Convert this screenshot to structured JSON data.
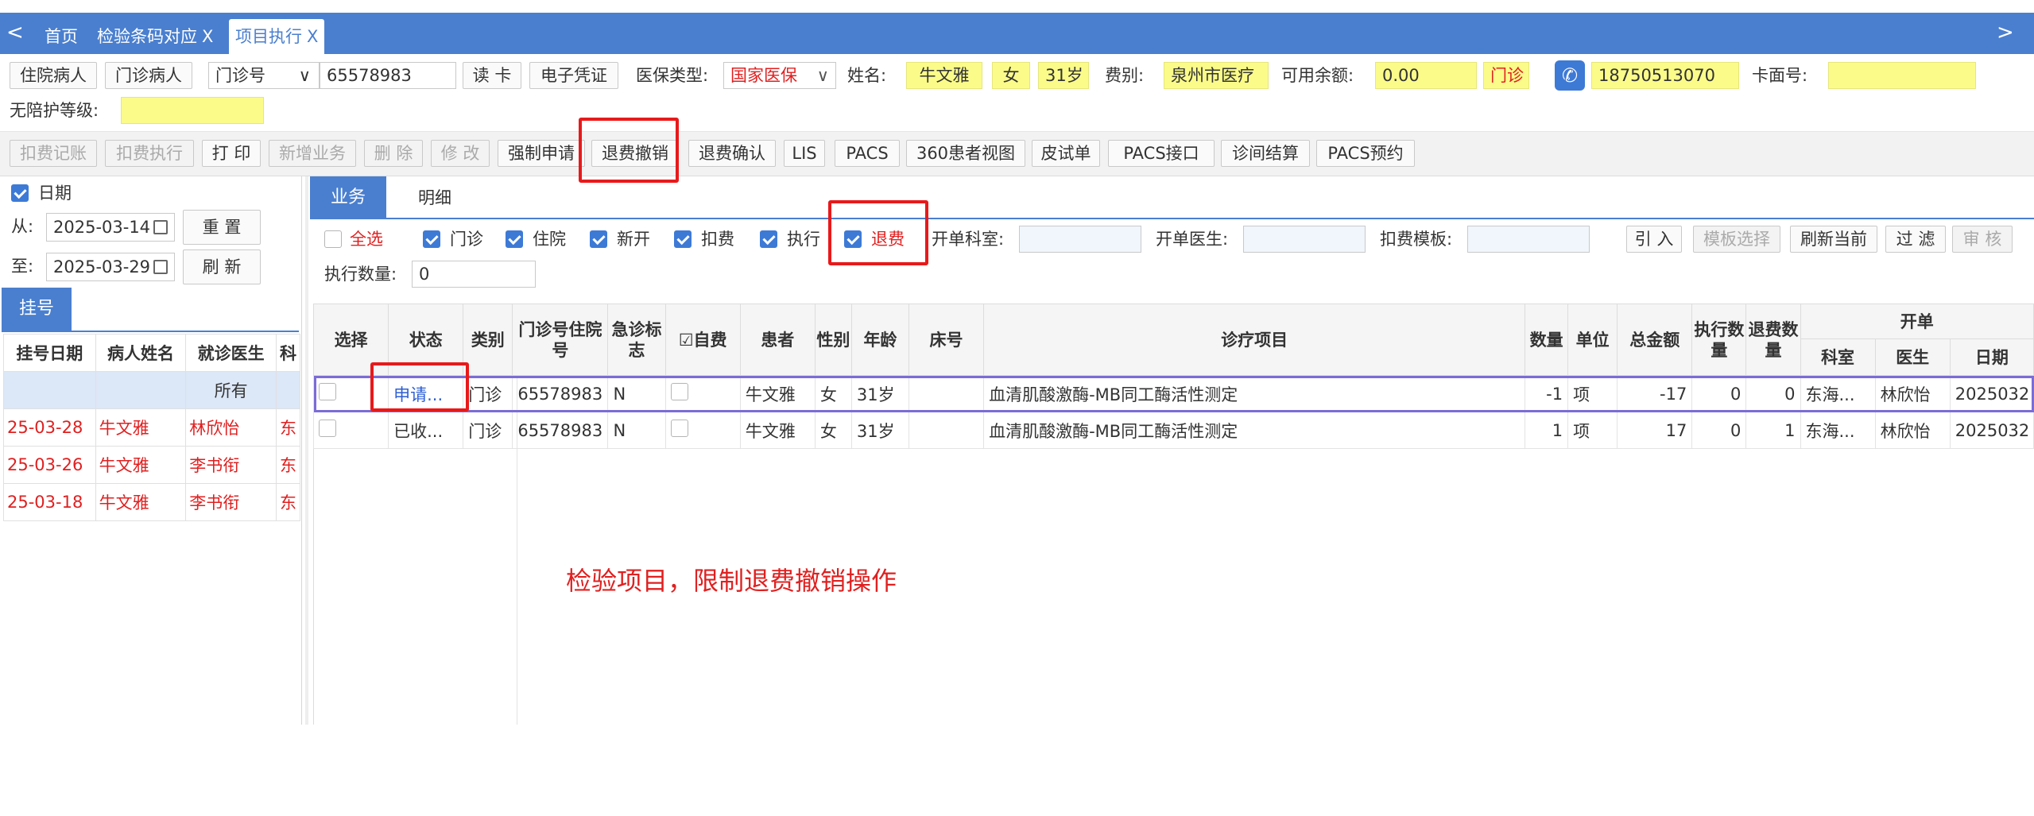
{
  "tabs": [
    {
      "label": "首页",
      "closable": false
    },
    {
      "label": "检验条码对应",
      "closable": true
    },
    {
      "label": "项目执行",
      "closable": true,
      "active": true
    }
  ],
  "nav": {
    "prev": "<",
    "next": ">"
  },
  "patient_bar": {
    "btn_inpatient": "住院病人",
    "btn_outpatient": "门诊病人",
    "id_type": "门诊号",
    "id_value": "65578983",
    "btn_read_card": "读 卡",
    "btn_e_voucher": "电子凭证",
    "insurance_label": "医保类型:",
    "insurance_value": "国家医保",
    "name_label": "姓名:",
    "name_value": "牛文雅",
    "gender": "女",
    "age": "31岁",
    "fee_label": "费别:",
    "fee_value": "泉州市医疗",
    "balance_label": "可用余额:",
    "balance_value": "0.00",
    "visit_type": "门诊",
    "phone": "18750513070",
    "card_label": "卡面号:",
    "card_value": "",
    "care_label": "无陪护等级:",
    "care_value": ""
  },
  "toolbar": [
    {
      "label": "扣费记账",
      "disabled": true
    },
    {
      "label": "扣费执行",
      "disabled": true
    },
    {
      "label": "打 印",
      "disabled": false
    },
    {
      "label": "新增业务",
      "disabled": true
    },
    {
      "label": "删 除",
      "disabled": true
    },
    {
      "label": "修 改",
      "disabled": true
    },
    {
      "label": "强制申请",
      "disabled": false
    },
    {
      "label": "退费撤销",
      "disabled": false
    },
    {
      "label": "退费确认",
      "disabled": false
    },
    {
      "label": "LIS",
      "disabled": false
    },
    {
      "label": "PACS",
      "disabled": false
    },
    {
      "label": "360患者视图",
      "disabled": false
    },
    {
      "label": "皮试单",
      "disabled": false
    },
    {
      "label": "PACS接口",
      "disabled": false
    },
    {
      "label": "诊间结算",
      "disabled": false
    },
    {
      "label": "PACS预约",
      "disabled": false
    }
  ],
  "left": {
    "date_check": "日期",
    "from_label": "从:",
    "from_value": "2025-03-14",
    "to_label": "至:",
    "to_value": "2025-03-29",
    "btn_reset": "重 置",
    "btn_refresh": "刷 新",
    "tab_register": "挂号",
    "headers": [
      "挂号日期",
      "病人姓名",
      "就诊医生",
      "科"
    ],
    "filter_all": "所有",
    "rows": [
      [
        "25-03-28",
        "牛文雅",
        "林欣怡",
        "东"
      ],
      [
        "25-03-26",
        "牛文雅",
        "李书衔",
        "东"
      ],
      [
        "25-03-18",
        "牛文雅",
        "李书衔",
        "东"
      ]
    ]
  },
  "main": {
    "tab_business": "业务",
    "tab_detail": "明细",
    "filters": {
      "all": "全选",
      "outpatient": "门诊",
      "inpatient": "住院",
      "new": "新开",
      "charge": "扣费",
      "execute": "执行",
      "refund": "退费"
    },
    "dept_label": "开单科室:",
    "doctor_label": "开单医生:",
    "template_label": "扣费模板:",
    "btn_import": "引 入",
    "btn_template": "模板选择",
    "btn_refresh_current": "刷新当前",
    "btn_filter": "过 滤",
    "btn_audit": "审 核",
    "exec_qty_label": "执行数量:",
    "exec_qty_value": "0",
    "headers": {
      "select": "选择",
      "status": "状态",
      "category": "类别",
      "visit_no": "门诊号住院号",
      "urgent": "急诊标志",
      "self_pay": "自费",
      "patient": "患者",
      "gender": "性别",
      "age": "年龄",
      "bed": "床号",
      "item": "诊疗项目",
      "qty": "数量",
      "unit": "单位",
      "total": "总金额",
      "exec_qty": "执行数量",
      "refund_qty": "退费数量",
      "order_group": "开单",
      "dept": "科室",
      "doctor": "医生",
      "date": "日期"
    },
    "rows": [
      {
        "status": "申请...",
        "category": "门诊",
        "visit_no": "65578983",
        "urgent": "N",
        "patient": "牛文雅",
        "gender": "女",
        "age": "31岁",
        "bed": "",
        "item": "血清肌酸激酶-MB同工酶活性测定",
        "qty": "-1",
        "unit": "项",
        "total": "-17",
        "exec_qty": "0",
        "refund_qty": "0",
        "dept": "东海...",
        "doctor": "林欣怡",
        "date": "2025032"
      },
      {
        "status": "已收...",
        "category": "门诊",
        "visit_no": "65578983",
        "urgent": "N",
        "patient": "牛文雅",
        "gender": "女",
        "age": "31岁",
        "bed": "",
        "item": "血清肌酸激酶-MB同工酶活性测定",
        "qty": "1",
        "unit": "项",
        "total": "17",
        "exec_qty": "0",
        "refund_qty": "1",
        "dept": "东海...",
        "doctor": "林欣怡",
        "date": "2025032"
      }
    ]
  },
  "annotation": "检验项目，限制退费撤销操作",
  "colors": {
    "header_blue": "#4a7fcf",
    "highlight_red": "#e8191a",
    "field_yellow": "#fbfb8a",
    "text_red": "#e02020"
  }
}
